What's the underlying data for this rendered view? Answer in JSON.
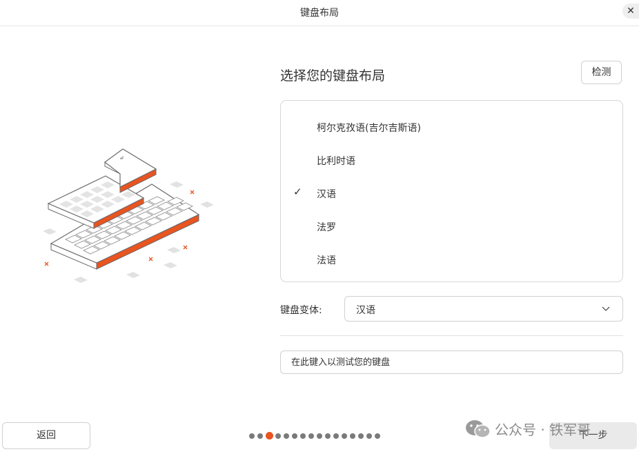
{
  "window": {
    "title": "键盘布局",
    "close_glyph": "✕"
  },
  "main": {
    "heading": "选择您的键盘布局",
    "detect_label": "检测",
    "layouts": [
      {
        "label": "柯尔克孜语(吉尔吉斯语)",
        "selected": false
      },
      {
        "label": "比利时语",
        "selected": false
      },
      {
        "label": "汉语",
        "selected": true
      },
      {
        "label": "法罗",
        "selected": false
      },
      {
        "label": "法语",
        "selected": false
      }
    ],
    "check_glyph": "✓",
    "variant_label": "键盘变体:",
    "variant_value": "汉语",
    "test_placeholder": "在此键入以测试您的键盘"
  },
  "footer": {
    "back_label": "返回",
    "next_label": "下一步",
    "steps_total": 16,
    "steps_current": 3
  },
  "watermark": {
    "text": "公众号 · 铁军哥"
  },
  "colors": {
    "accent": "#e95420",
    "dot": "#7a7a7a"
  }
}
